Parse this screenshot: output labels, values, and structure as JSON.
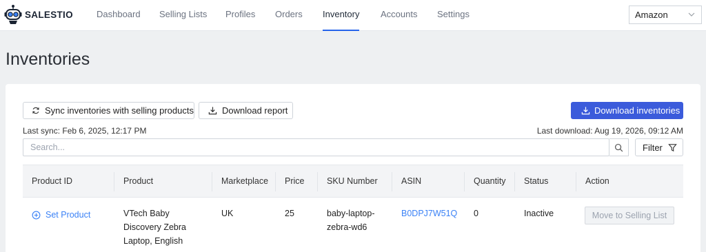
{
  "brand": {
    "name": "SALESTIO"
  },
  "nav": {
    "items": [
      {
        "label": "Dashboard"
      },
      {
        "label": "Selling Lists"
      },
      {
        "label": "Profiles"
      },
      {
        "label": "Orders"
      },
      {
        "label": "Inventory",
        "active": true
      },
      {
        "label": "Accounts"
      },
      {
        "label": "Settings"
      }
    ],
    "marketplace": "Amazon"
  },
  "page": {
    "title": "Inventories"
  },
  "toolbar": {
    "sync_label": "Sync inventories with selling products",
    "download_report_label": "Download report",
    "download_inventories_label": "Download inventories",
    "last_sync": "Last sync: Feb 6, 2025, 12:17 PM",
    "last_download": "Last download: Aug 19, 2026, 09:12 AM"
  },
  "search": {
    "placeholder": "Search...",
    "filter_label": "Filter"
  },
  "table": {
    "headers": [
      "Product ID",
      "Product",
      "Marketplace",
      "Price",
      "SKU Number",
      "ASIN",
      "Quantity",
      "Status",
      "Action"
    ],
    "rows": [
      {
        "product_id_action": "Set Product",
        "product_lines": [
          "VTech Baby",
          "Discovery Zebra",
          "Laptop, English"
        ],
        "marketplace": "UK",
        "price": "25",
        "sku_lines": [
          "baby-laptop-",
          "zebra-wd6"
        ],
        "asin": "B0DPJ7W51Q",
        "quantity": "0",
        "status": "Inactive",
        "action": "Move to Selling List"
      }
    ]
  },
  "colors": {
    "accent": "#3b5bdb",
    "link": "#3b82f6",
    "active_tab": "#2563eb"
  },
  "icons": [
    "robot-logo-icon",
    "chevron-down-icon",
    "refresh-icon",
    "download-icon",
    "search-icon",
    "filter-icon",
    "plus-circle-icon"
  ]
}
